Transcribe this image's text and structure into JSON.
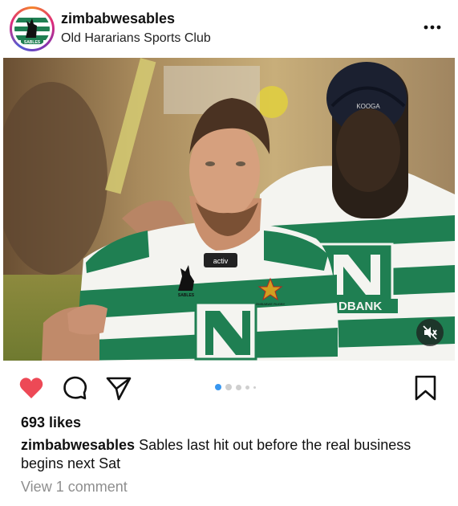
{
  "post": {
    "username": "zimbabwesables",
    "location": "Old Hararians Sports Club",
    "avatar_text": "SABLES",
    "more_icon": "more-horizontal-icon",
    "media": {
      "jersey_sponsor": "activ",
      "jersey_badge": "SABLES",
      "jersey_crest": "ZIMBABWE RUGBY",
      "sponsor_text": "DBANK",
      "helmet_brand": "KOOGA",
      "colors": {
        "green": "#1f7f52",
        "white": "#f4f4f0",
        "background": "#b79663"
      }
    },
    "mute_icon": "speaker-muted-icon",
    "actions": {
      "like_icon": "heart-filled-icon",
      "like_color": "#ed4956",
      "comment_icon": "comment-bubble-icon",
      "share_icon": "paper-plane-icon",
      "save_icon": "bookmark-icon"
    },
    "carousel": {
      "total_indicators": 5,
      "active_index": 0,
      "active_color": "#3897f0"
    },
    "likes": "693 likes",
    "caption_username": "zimbabwesables",
    "caption_text": "Sables last hit out before the real business begins next Sat",
    "view_comments": "View 1 comment"
  }
}
